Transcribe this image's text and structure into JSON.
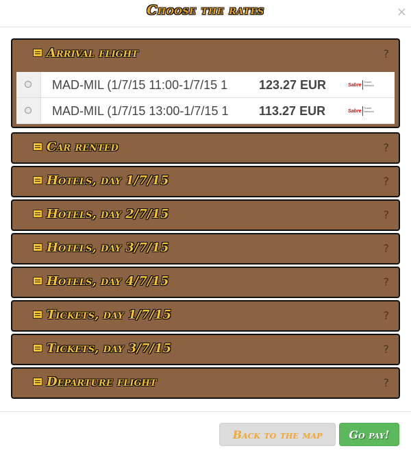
{
  "dialog": {
    "title": "Choose the rates",
    "close_glyph": "×",
    "help_glyph": "?"
  },
  "panels": [
    {
      "title": "Arrival flight",
      "icon": "list-icon",
      "rows": [
        {
          "route": "MAD-MIL (1/7/15 11:00-1/7/15 1",
          "price": "123.27 EUR",
          "provider": "Sabre",
          "provider_tag": "Travel Network"
        },
        {
          "route": "MAD-MIL (1/7/15 13:00-1/7/15 1",
          "price": "113.27 EUR",
          "provider": "Sabre",
          "provider_tag": "Travel Network"
        }
      ]
    },
    {
      "title": "Car rented",
      "icon": "list-icon"
    },
    {
      "title": "Hotels, day 1/7/15",
      "icon": "list-icon"
    },
    {
      "title": "Hotels, day 2/7/15",
      "icon": "list-icon"
    },
    {
      "title": "Hotels, day 3/7/15",
      "icon": "list-icon"
    },
    {
      "title": "Hotels, day 4/7/15",
      "icon": "list-icon"
    },
    {
      "title": "Tickets, day 1/7/15",
      "icon": "list-icon"
    },
    {
      "title": "Tickets, day 3/7/15",
      "icon": "list-icon"
    },
    {
      "title": "Departure flight",
      "icon": "list-icon"
    }
  ],
  "footer": {
    "back_label": "Back to the map",
    "go_label": "Go pay!"
  },
  "colors": {
    "panel_bg": "#8b6343",
    "title_gold": "#f3c230",
    "go_green": "#5cb85c"
  }
}
